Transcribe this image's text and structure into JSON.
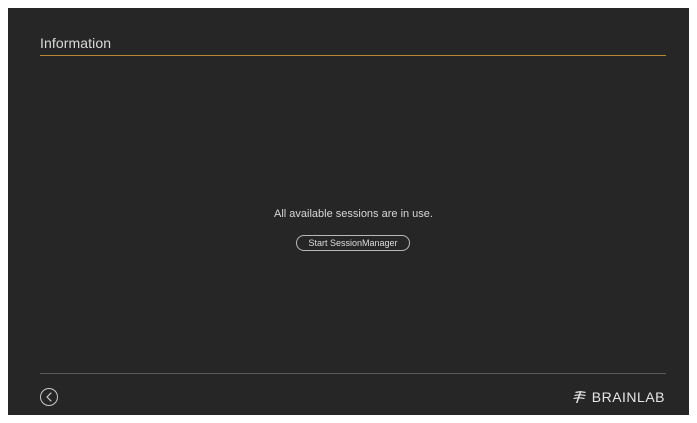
{
  "header": {
    "title": "Information"
  },
  "main": {
    "message": "All available sessions are in use.",
    "start_button_label": "Start SessionManager"
  },
  "footer": {
    "back_icon": "chevron-left-circle-icon",
    "brand_icon": "brainlab-logo-icon",
    "brand_name": "BRAINLAB"
  },
  "colors": {
    "background": "#262626",
    "accent_rule": "#b78a32",
    "text": "#d9d9d9"
  }
}
